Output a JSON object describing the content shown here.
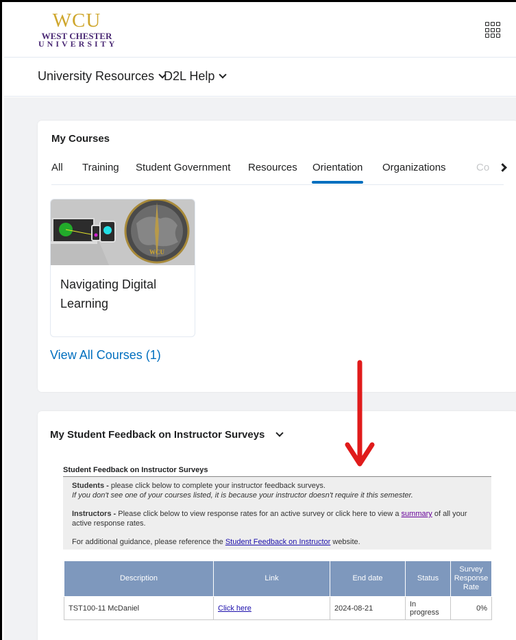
{
  "brand": {
    "logo_line1": "WCU",
    "logo_line2": "WEST CHESTER",
    "logo_line3": "UNIVERSITY",
    "purple": "#4b2a75",
    "gold": "#cfa72e"
  },
  "header": {
    "apps_icon": "waffle-grid-icon"
  },
  "nav": {
    "items": [
      {
        "label": "University Resources"
      },
      {
        "label": "D2L Help"
      }
    ]
  },
  "my_courses": {
    "title": "My Courses",
    "tabs": [
      "All",
      "Training",
      "Student Government",
      "Resources",
      "Orientation",
      "Organizations",
      "Co"
    ],
    "active_tab": "Orientation",
    "courses": [
      {
        "name": "Navigating Digital Learning"
      }
    ],
    "view_all": "View All Courses (1)"
  },
  "feedback_widget": {
    "title": "My Student Feedback on Instructor Surveys",
    "box_title": "Student Feedback on Instructor Surveys",
    "students_bold": "Students -",
    "students_text": " please click below to complete your instructor feedback surveys.",
    "students_italic": "If you don't see one of your courses listed, it is because your instructor doesn't require it this semester.",
    "instructors_bold": "Instructors -",
    "instructors_text": " Please click below to view response rates for an active survey or click here to view a ",
    "summary_link": "summary",
    "instructors_tail": " of all your active response rates.",
    "guidance_text": "For additional guidance, please reference the ",
    "guidance_link": "Student Feedback on Instructor",
    "guidance_tail": " website.",
    "table": {
      "headers": [
        "Description",
        "Link",
        "End date",
        "Status",
        "Survey Response Rate"
      ],
      "rows": [
        [
          "TST100-11 McDaniel",
          "Click here",
          "2024-08-21",
          "In progress",
          "0%"
        ]
      ]
    }
  },
  "colors": {
    "accent_blue": "#006fbf",
    "table_header": "#7e98bd",
    "annotation_arrow": "#e01b1b"
  }
}
